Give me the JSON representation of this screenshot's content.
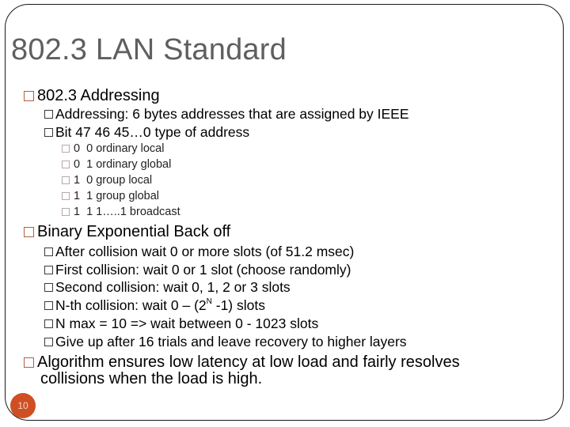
{
  "slide": {
    "title": "802.3 LAN Standard",
    "page_number": "10",
    "accent_color": "#cf4f22"
  },
  "bullets": {
    "addressing": {
      "label": "802.3 Addressing",
      "items": [
        "Addressing: 6 bytes addresses that are assigned by IEEE",
        "Bit 47 46 45…0 type of address"
      ],
      "address_types": [
        "0  0 ordinary local",
        "0  1 ordinary global",
        "1  0 group local",
        "1  1 group global",
        "1  1 1…..1 broadcast"
      ]
    },
    "backoff": {
      "label": "Binary Exponential Back off",
      "items": [
        "After collision wait 0 or more slots (of 51.2 msec)",
        "First collision: wait 0 or 1 slot (choose randomly)",
        "Second collision: wait 0, 1, 2 or 3 slots"
      ],
      "nth_prefix": "N-th collision: wait 0 – (2",
      "nth_sup": "N",
      "nth_suffix": " -1) slots",
      "items_after": [
        "N max = 10 => wait between 0 - 1023 slots",
        "Give up after 16 trials and leave recovery to higher layers"
      ]
    },
    "algorithm": {
      "line1": "Algorithm ensures low latency at low load and fairly resolves",
      "line2": "collisions when the load is high."
    }
  }
}
